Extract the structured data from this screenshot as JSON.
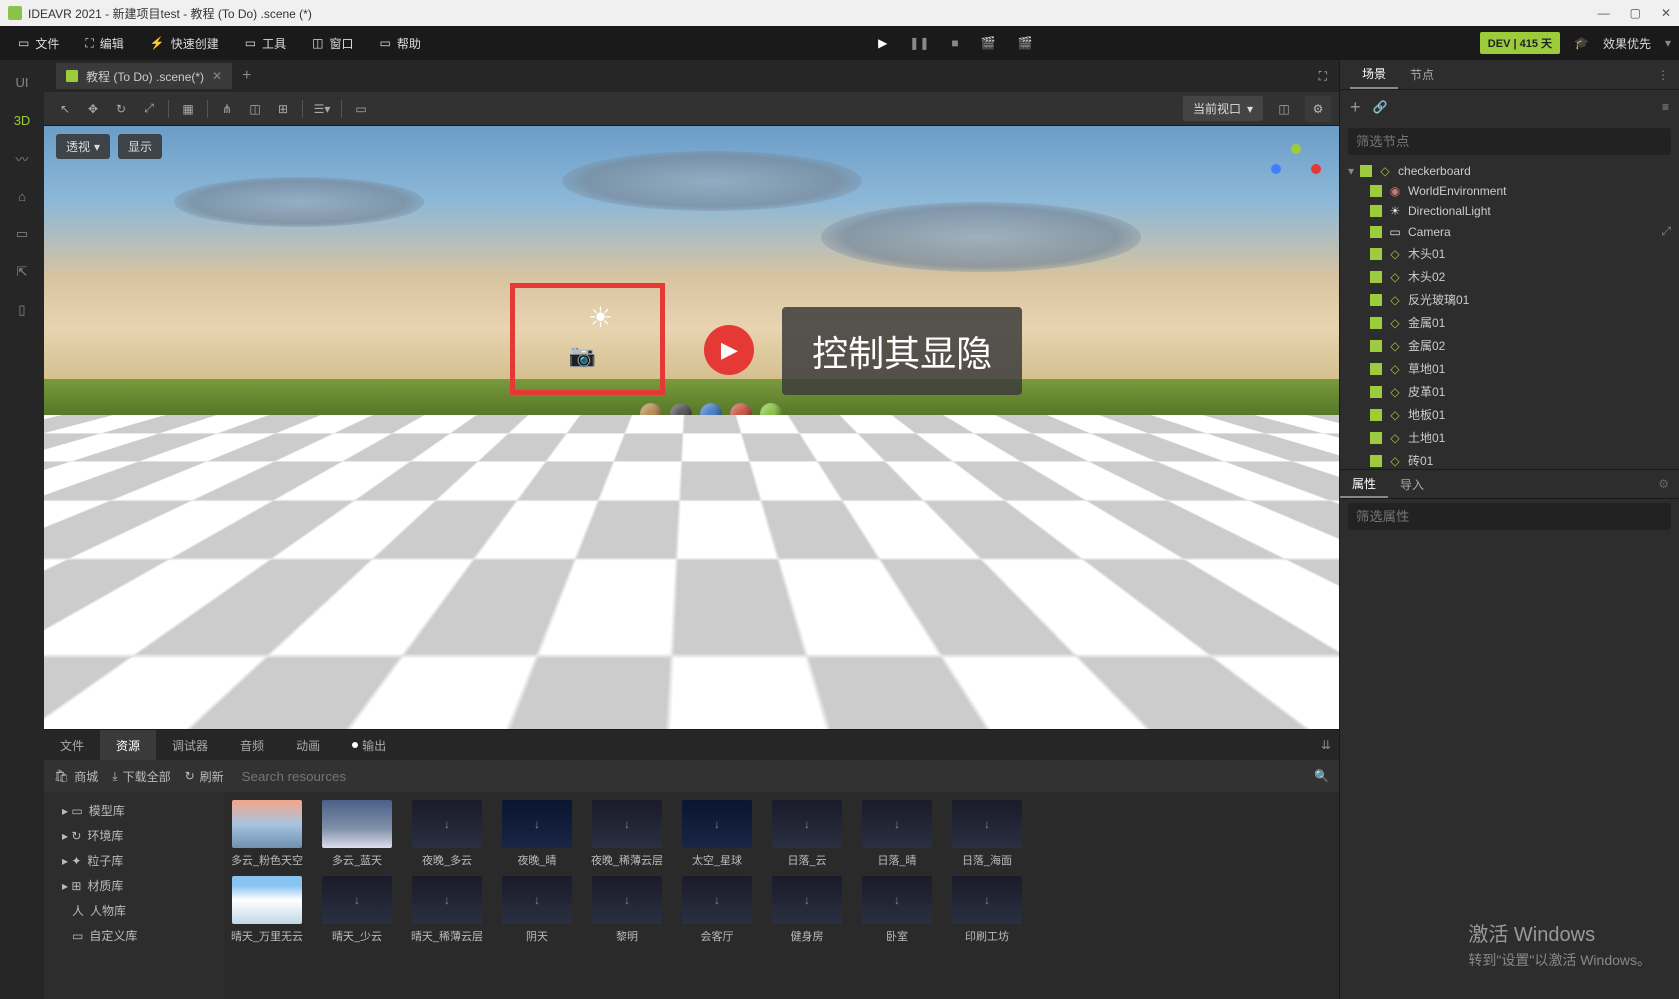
{
  "title": "IDEAVR 2021 - 新建项目test - 教程 (To Do) .scene (*)",
  "menubar": {
    "file": "文件",
    "edit": "编辑",
    "quick_create": "快速创建",
    "tools": "工具",
    "window": "窗口",
    "help": "帮助",
    "dev_badge": "DEV | 415 天",
    "effect_priority": "效果优先"
  },
  "left_rail": {
    "ui": "UI",
    "three_d": "3D"
  },
  "tab": {
    "label": "教程 (To Do) .scene(*)"
  },
  "viewport_toolbar": {
    "current_view": "当前视口"
  },
  "viewport_overlay": {
    "perspective": "透视",
    "display": "显示"
  },
  "tooltip": "控制其显隐",
  "bottom": {
    "tabs": {
      "file": "文件",
      "resource": "资源",
      "debugger": "调试器",
      "audio": "音频",
      "animation": "动画",
      "output": "输出"
    },
    "sub": {
      "store": "商城",
      "download_all": "下载全部",
      "refresh": "刷新",
      "search_placeholder": "Search resources"
    },
    "tree": {
      "model": "模型库",
      "env": "环境库",
      "particle": "粒子库",
      "material": "材质库",
      "character": "人物库",
      "custom": "自定义库"
    },
    "items_row1": [
      "多云_粉色天空",
      "多云_蓝天",
      "夜晚_多云",
      "夜晚_晴",
      "夜晚_稀薄云层",
      "太空_星球",
      "日落_云",
      "日落_晴",
      "日落_海面"
    ],
    "items_row2": [
      "晴天_万里无云",
      "晴天_少云",
      "晴天_稀薄云层",
      "阴天",
      "黎明",
      "会客厅",
      "健身房",
      "卧室",
      "印刷工坊"
    ]
  },
  "right": {
    "tabs": {
      "scene": "场景",
      "node": "节点"
    },
    "filter_placeholder": "筛选节点",
    "root": "checkerboard",
    "nodes": [
      {
        "name": "WorldEnvironment",
        "icon": "◉",
        "color": "#c77"
      },
      {
        "name": "DirectionalLight",
        "icon": "☀",
        "color": "#ddd"
      },
      {
        "name": "Camera",
        "icon": "▭",
        "color": "#ddd"
      },
      {
        "name": "木头01",
        "icon": "◇",
        "color": "#9ccc3c"
      },
      {
        "name": "木头02",
        "icon": "◇",
        "color": "#9ccc3c"
      },
      {
        "name": "反光玻璃01",
        "icon": "◇",
        "color": "#9ccc3c"
      },
      {
        "name": "金属01",
        "icon": "◇",
        "color": "#9ccc3c"
      },
      {
        "name": "金属02",
        "icon": "◇",
        "color": "#9ccc3c"
      },
      {
        "name": "草地01",
        "icon": "◇",
        "color": "#9ccc3c"
      },
      {
        "name": "皮革01",
        "icon": "◇",
        "color": "#9ccc3c"
      },
      {
        "name": "地板01",
        "icon": "◇",
        "color": "#9ccc3c"
      },
      {
        "name": "土地01",
        "icon": "◇",
        "color": "#9ccc3c"
      },
      {
        "name": "砖01",
        "icon": "◇",
        "color": "#9ccc3c"
      }
    ],
    "prop_tabs": {
      "properties": "属性",
      "import": "导入"
    },
    "filter_prop_placeholder": "筛选属性"
  },
  "watermark": {
    "big": "激活 Windows",
    "small": "转到\"设置\"以激活 Windows。"
  }
}
